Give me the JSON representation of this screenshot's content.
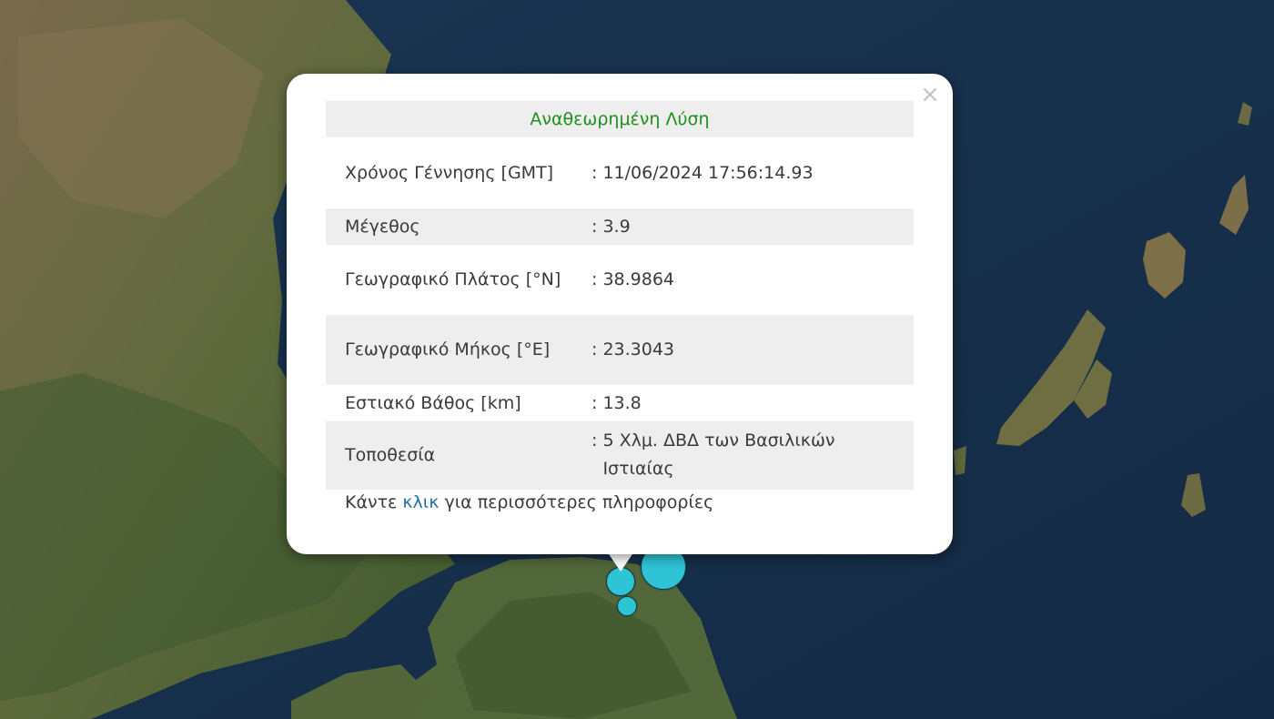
{
  "popup": {
    "title": "Αναθεωρημένη Λύση",
    "close_glyph": "×",
    "rows": [
      {
        "label": "Χρόνος Γέννησης [GMT]",
        "value": "11/06/2024 17:56:14.93"
      },
      {
        "label": "Μέγεθος",
        "value": "3.9"
      },
      {
        "label": "Γεωγραφικό Πλάτος [°N]",
        "value": "38.9864"
      },
      {
        "label": "Γεωγραφικό Μήκος [°E]",
        "value": "23.3043"
      },
      {
        "label": "Εστιακό Βάθος [km]",
        "value": "13.8"
      },
      {
        "label": "Τοποθεσία",
        "value": "5 Χλμ. ΔΒΔ των Βασιλικών Ιστιαίας"
      }
    ],
    "colon": ": ",
    "more_prefix": "Κάντε ",
    "more_link": "κλικ",
    "more_suffix": " για περισσότερες πληροφορίες"
  },
  "colors": {
    "sea": "#17324d",
    "land": "#5a6a3a",
    "quake_marker": "#2ec4d6",
    "title_green": "#1f8f1f",
    "link_blue": "#2472a4"
  }
}
